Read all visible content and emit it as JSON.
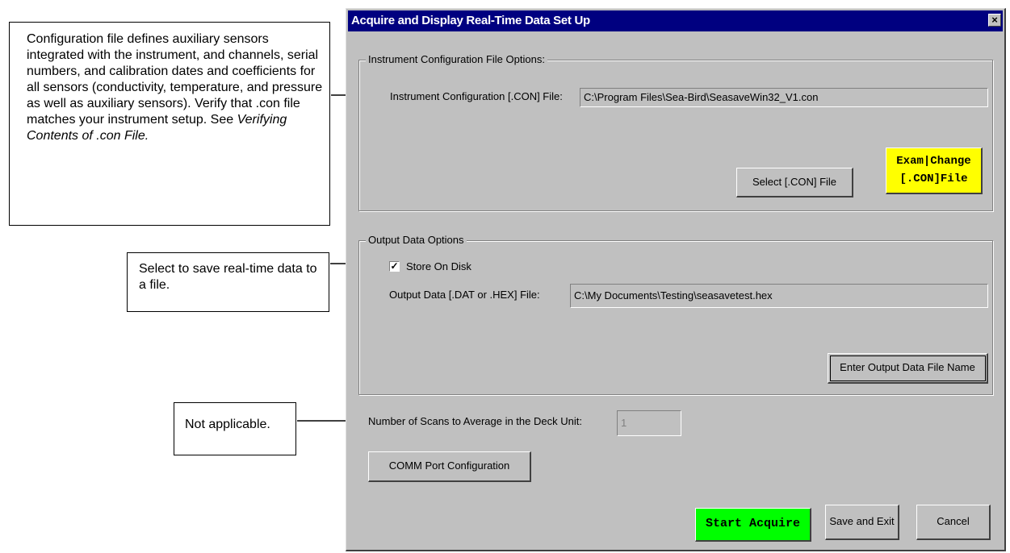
{
  "callouts": {
    "config": {
      "text": "Configuration file defines auxiliary sensors integrated with the instrument, and channels, serial numbers, and calibration dates and coefficients for all sensors (conductivity, temperature, and pressure as well as auxiliary sensors). Verify that .con file matches your instrument setup. See ",
      "italic": "Verifying Contents of .con File."
    },
    "store": "Select to save real-time data to a file.",
    "na": "Not applicable."
  },
  "dialog": {
    "title": "Acquire and Display Real-Time Data Set Up",
    "close_label": "×",
    "config_group": {
      "legend": "Instrument Configuration File Options:",
      "label": "Instrument Configuration [.CON] File:",
      "value": "C:\\Program Files\\Sea-Bird\\SeasaveWin32_V1.con",
      "select_button": "Select [.CON] File",
      "exam_line1": "Exam|Change",
      "exam_line2": "[.CON]File"
    },
    "output_group": {
      "legend": "Output Data Options",
      "store_label": "Store On Disk",
      "store_checked": true,
      "check_mark": "✓",
      "file_label": "Output Data [.DAT or .HEX] File:",
      "file_value": "C:\\My Documents\\Testing\\seasavetest.hex",
      "enter_button": "Enter Output Data File Name"
    },
    "scans_label": "Number of Scans to Average in the Deck Unit:",
    "scans_value": "1",
    "comm_button": "COMM Port Configuration",
    "start_button": "Start Acquire",
    "save_button": "Save and Exit",
    "cancel_button": "Cancel"
  },
  "colors": {
    "title_bar": "#000080",
    "dialog_face": "#c0c0c0",
    "exam_button": "#ffff00",
    "start_button": "#00ff00"
  }
}
